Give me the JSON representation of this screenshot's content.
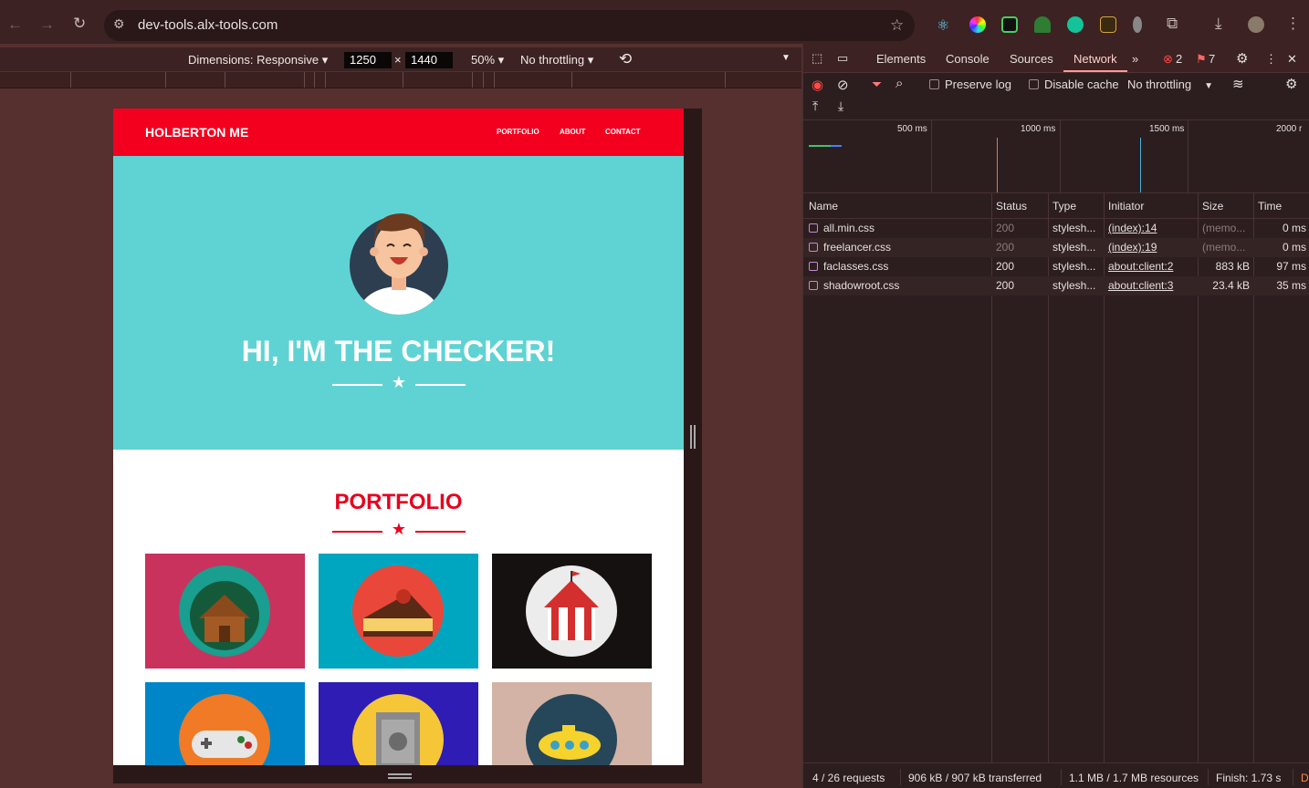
{
  "browser": {
    "url": "dev-tools.alx-tools.com"
  },
  "emulation": {
    "dimensions_label": "Dimensions: Responsive",
    "width": "1250",
    "height": "1440",
    "times": "×",
    "zoom": "50%",
    "throttling": "No throttling"
  },
  "site": {
    "brand": "HOLBERTON ME",
    "nav": [
      "PORTFOLIO",
      "ABOUT",
      "CONTACT"
    ],
    "hero_title": "HI, I'M THE CHECKER!",
    "portfolio_title": "PORTFOLIO",
    "tile_colors": [
      "#c9325d",
      "#00a6bf",
      "#151111",
      "#0086c8",
      "#2f1cb4",
      "#d2b3a5"
    ]
  },
  "devtools": {
    "tabs": [
      "Elements",
      "Console",
      "Sources",
      "Network"
    ],
    "active_tab": "Network",
    "error_count": "2",
    "warning_count": "7",
    "preserve_log": "Preserve log",
    "disable_cache": "Disable cache",
    "throttling": "No throttling",
    "timeline_labels": [
      "500 ms",
      "1000 ms",
      "1500 ms",
      "2000 r"
    ],
    "columns": [
      "Name",
      "Status",
      "Type",
      "Initiator",
      "Size",
      "Time"
    ],
    "requests": [
      {
        "name": "all.min.css",
        "status": "200",
        "type": "stylesh...",
        "initiator": "(index):14",
        "size": "(memo...",
        "time": "0 ms"
      },
      {
        "name": "freelancer.css",
        "status": "200",
        "type": "stylesh...",
        "initiator": "(index):19",
        "size": "(memo...",
        "time": "0 ms"
      },
      {
        "name": "faclasses.css",
        "status": "200",
        "type": "stylesh...",
        "initiator": "about:client:2",
        "size": "883 kB",
        "time": "97 ms"
      },
      {
        "name": "shadowroot.css",
        "status": "200",
        "type": "stylesh...",
        "initiator": "about:client:3",
        "size": "23.4 kB",
        "time": "35 ms"
      }
    ],
    "summary": {
      "requests": "4 / 26 requests",
      "transferred": "906 kB / 907 kB transferred",
      "resources": "1.1 MB / 1.7 MB resources",
      "finish": "Finish: 1.73 s",
      "trailing": "D"
    }
  }
}
